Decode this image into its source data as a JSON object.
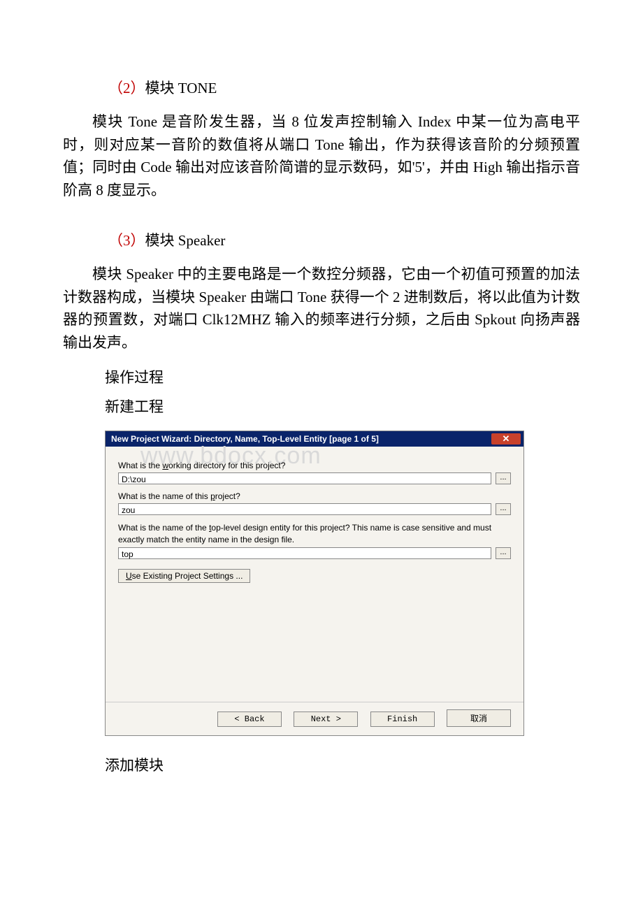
{
  "section2": {
    "prefix": "（2）",
    "title_cn": "模块 ",
    "title_en": "TONE",
    "para": "模块 Tone 是音阶发生器，当 8 位发声控制输入 Index 中某一位为高电平时，则对应某一音阶的数值将从端口 Tone 输出，作为获得该音阶的分频预置值；同时由 Code 输出对应该音阶简谱的显示数码，如'5'，并由 High 输出指示音阶高 8 度显示。"
  },
  "section3": {
    "prefix": "（3）",
    "title_cn": "模块 ",
    "title_en": "Speaker",
    "para": "模块 Speaker 中的主要电路是一个数控分频器，它由一个初值可预置的加法计数器构成，当模块 Speaker 由端口 Tone 获得一个 2 进制数后，将以此值为计数器的预置数，对端口 Clk12MHZ 输入的频率进行分频，之后由 Spkout 向扬声器输出发声。"
  },
  "lines": {
    "op_process": "操作过程",
    "new_project": "新建工程",
    "add_module": "添加模块"
  },
  "dialog": {
    "title": "New Project Wizard: Directory, Name, Top-Level Entity [page 1 of 5]",
    "close": "✕",
    "watermark": "www.bdocx.com",
    "label_dir_pre": "What is the ",
    "label_dir_ul": "w",
    "label_dir_post": "orking directory for this project?",
    "input_dir": "D:\\zou",
    "label_name_pre": "What is the name of this ",
    "label_name_ul": "p",
    "label_name_post": "roject?",
    "input_name": "zou",
    "label_top_pre": "What is the name of the ",
    "label_top_ul": "t",
    "label_top_post": "op-level design entity for this project? This name is case sensitive and must exactly match the entity name in the design file.",
    "input_top": "top",
    "browse": "...",
    "settings_ul": "U",
    "settings_post": "se Existing Project Settings ...",
    "btn_back": "< Back",
    "btn_next": "Next >",
    "btn_finish": "Finish",
    "btn_cancel": "取消"
  }
}
